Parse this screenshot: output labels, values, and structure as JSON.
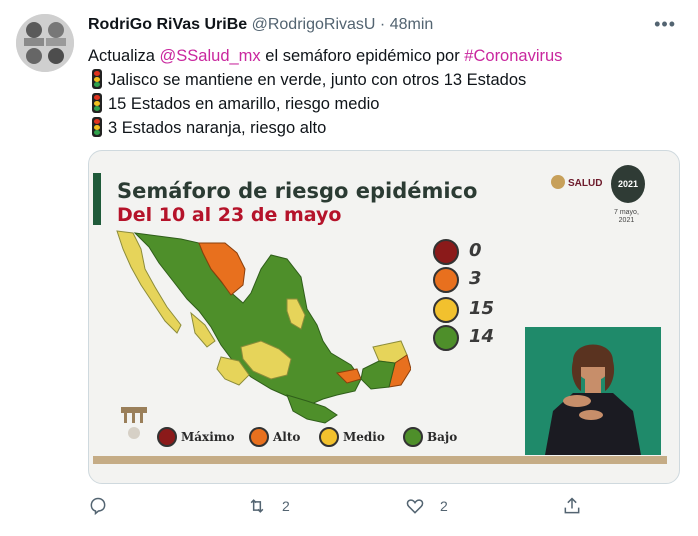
{
  "tweet": {
    "author_name": "RodriGo RiVas UriBe",
    "handle": "@RodrigoRivasU",
    "separator": "·",
    "time": "48min",
    "more_icon": "more-horizontal-icon",
    "text": {
      "intro_prefix": "Actualiza ",
      "mention": "@SSalud_mx",
      "intro_middle": " el semáforo epidémico por ",
      "hashtag": "#Coronavirus",
      "line1": "Jalisco se mantiene en verde, junto con otros 13 Estados",
      "line2": "15 Estados en amarillo, riesgo medio",
      "line3": "3 Estados naranja, riesgo alto"
    }
  },
  "card": {
    "title": "Semáforo de riesgo epidémico",
    "subtitle": "Del 10 al 23 de mayo",
    "salud_label": "SALUD",
    "emblem_text": "2021",
    "date_note_line1": "7 mayo,",
    "date_note_line2": "2021",
    "counts": [
      {
        "level": "maximo",
        "value": "0",
        "color": "#8b1a1a"
      },
      {
        "level": "alto",
        "value": "3",
        "color": "#e8701e"
      },
      {
        "level": "medio",
        "value": "15",
        "color": "#f2c12e"
      },
      {
        "level": "bajo",
        "value": "14",
        "color": "#4e8f2a"
      }
    ],
    "legend": [
      {
        "label": "Máximo",
        "color": "#8b1a1a"
      },
      {
        "label": "Alto",
        "color": "#e8701e"
      },
      {
        "label": "Medio",
        "color": "#f2c12e"
      },
      {
        "label": "Bajo",
        "color": "#4e8f2a"
      }
    ],
    "colors": {
      "green": "#4e8f2a",
      "yellow": "#e6d45a",
      "orange": "#e8701e"
    }
  },
  "actions": {
    "reply_count": "",
    "retweet_count": "2",
    "like_count": "2",
    "share_count": ""
  },
  "theme": {
    "text_color": "#0f1419",
    "secondary_color": "#536471",
    "link_color": "#c9279e"
  }
}
